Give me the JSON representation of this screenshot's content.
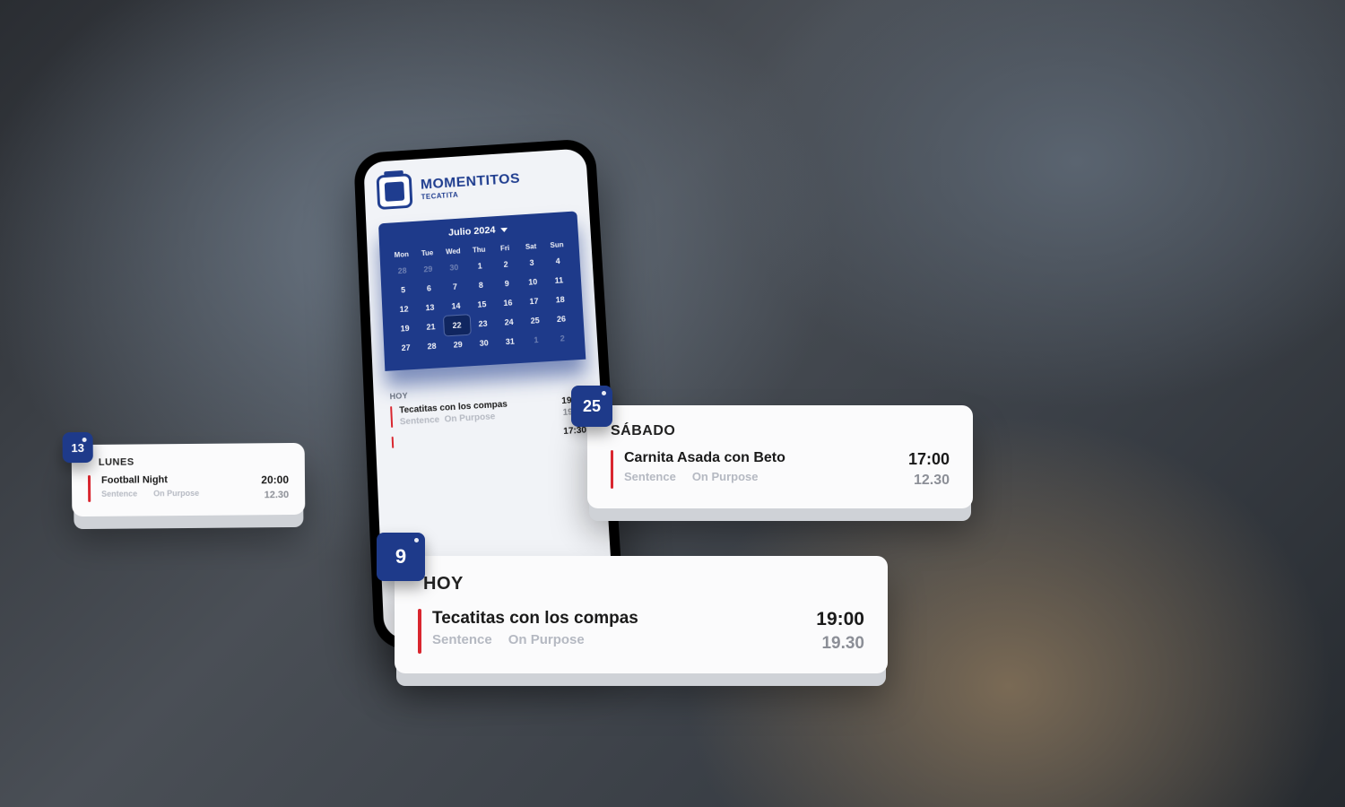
{
  "brand": {
    "name": "MOMENTITOS",
    "sub": "TECATITA"
  },
  "calendar": {
    "month_label": "Julio 2024",
    "dow": [
      "Mon",
      "Tue",
      "Wed",
      "Thu",
      "Fri",
      "Sat",
      "Sun"
    ],
    "weeks": [
      [
        {
          "n": "28",
          "prev": true
        },
        {
          "n": "29",
          "prev": true
        },
        {
          "n": "30",
          "prev": true
        },
        {
          "n": "1"
        },
        {
          "n": "2"
        },
        {
          "n": "3"
        },
        {
          "n": "4"
        }
      ],
      [
        {
          "n": "5"
        },
        {
          "n": "6"
        },
        {
          "n": "7"
        },
        {
          "n": "8"
        },
        {
          "n": "9"
        },
        {
          "n": "10"
        },
        {
          "n": "11"
        }
      ],
      [
        {
          "n": "12"
        },
        {
          "n": "13"
        },
        {
          "n": "14"
        },
        {
          "n": "15"
        },
        {
          "n": "16"
        },
        {
          "n": "17"
        },
        {
          "n": "18"
        }
      ],
      [
        {
          "n": "19"
        },
        {
          "n": "21"
        },
        {
          "n": "22",
          "sel": true
        },
        {
          "n": "23"
        },
        {
          "n": "24"
        },
        {
          "n": "25"
        },
        {
          "n": "26"
        }
      ],
      [
        {
          "n": "27"
        },
        {
          "n": "28"
        },
        {
          "n": "29"
        },
        {
          "n": "30"
        },
        {
          "n": "31"
        },
        {
          "n": "1",
          "prev": true
        },
        {
          "n": "2",
          "prev": true
        }
      ]
    ]
  },
  "agenda_phone": {
    "heading": "HOY",
    "items": [
      {
        "title": "Tecatitas con los compas",
        "sub1": "Sentence",
        "sub2": "On Purpose",
        "time": "19:00",
        "time2": "19.30"
      },
      {
        "title": "",
        "sub1": "",
        "sub2": "",
        "time": "17:30",
        "time2": ""
      }
    ]
  },
  "cards": {
    "lunes": {
      "badge": "13",
      "day": "LUNES",
      "title": "Football Night",
      "sub1": "Sentence",
      "sub2": "On Purpose",
      "time": "20:00",
      "time2": "12.30"
    },
    "sabado": {
      "badge": "25",
      "day": "SÁBADO",
      "title": "Carnita Asada con Beto",
      "sub1": "Sentence",
      "sub2": "On Purpose",
      "time": "17:00",
      "time2": "12.30"
    },
    "hoy": {
      "badge": "9",
      "day": "HOY",
      "title": "Tecatitas con los compas",
      "sub1": "Sentence",
      "sub2": "On Purpose",
      "time": "19:00",
      "time2": "19.30"
    }
  }
}
